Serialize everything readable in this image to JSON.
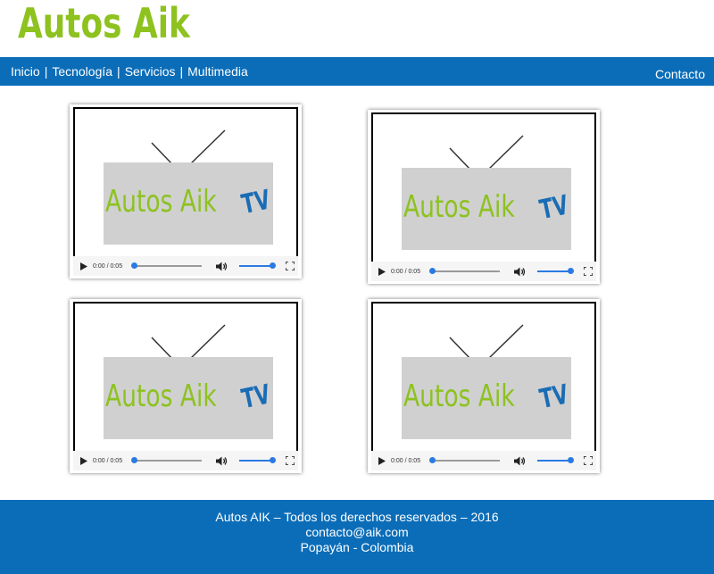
{
  "site": {
    "logo": "Autos Aik"
  },
  "nav": {
    "items": [
      {
        "label": "Inicio"
      },
      {
        "label": "Tecnología"
      },
      {
        "label": "Servicios"
      },
      {
        "label": "Multimedia"
      }
    ],
    "separator": "|",
    "contact": "Contacto"
  },
  "videos": [
    {
      "poster_text": "Autos Aik",
      "poster_badge": "TV",
      "time": "0:00 / 0:05",
      "progress": 0,
      "volume": 1
    },
    {
      "poster_text": "Autos Aik",
      "poster_badge": "TV",
      "time": "0:00 / 0:05",
      "progress": 0,
      "volume": 1
    },
    {
      "poster_text": "Autos Aik",
      "poster_badge": "TV",
      "time": "0:00 / 0:05",
      "progress": 0,
      "volume": 1
    },
    {
      "poster_text": "Autos Aik",
      "poster_badge": "TV",
      "time": "0:00 / 0:05",
      "progress": 0,
      "volume": 1
    }
  ],
  "icons": {
    "play": "play-icon",
    "volume": "volume-icon",
    "fullscreen": "fullscreen-icon"
  },
  "footer": {
    "line1": "Autos AIK – Todos los derechos reservados – 2016",
    "line2": "contacto@aik.com",
    "line3": "Popayán - Colombia"
  },
  "colors": {
    "brand_green": "#8dc21f",
    "brand_blue": "#0b6db8",
    "tv_blue": "#1a6cb5",
    "slider_blue": "#2a7ae2"
  }
}
